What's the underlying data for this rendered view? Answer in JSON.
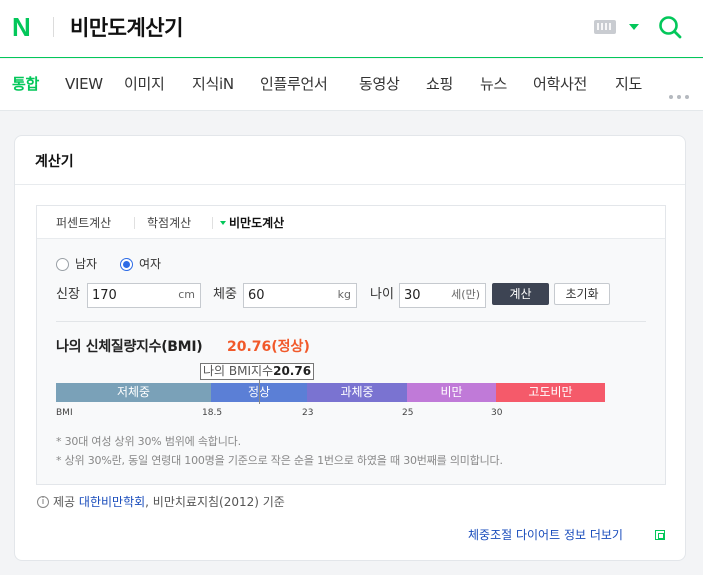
{
  "header": {
    "logo": "N",
    "search_query": "비만도계산기",
    "icons": [
      "keyboard-icon",
      "dropdown-triangle-icon",
      "search-icon"
    ]
  },
  "nav_tabs": [
    {
      "label": "통합",
      "active": true
    },
    {
      "label": "VIEW",
      "active": false
    },
    {
      "label": "이미지",
      "active": false
    },
    {
      "label": "지식iN",
      "active": false
    },
    {
      "label": "인플루언서",
      "active": false
    },
    {
      "label": "동영상",
      "active": false
    },
    {
      "label": "쇼핑",
      "active": false
    },
    {
      "label": "뉴스",
      "active": false
    },
    {
      "label": "어학사전",
      "active": false
    },
    {
      "label": "지도",
      "active": false
    }
  ],
  "calculator": {
    "title": "계산기",
    "tabs": [
      "퍼센트계산",
      "학점계산",
      "비만도계산"
    ],
    "active_tab": "비만도계산",
    "gender": {
      "options": [
        "남자",
        "여자"
      ],
      "selected": "여자"
    },
    "height": {
      "label": "신장",
      "value": "170",
      "unit": "cm"
    },
    "weight": {
      "label": "체중",
      "value": "60",
      "unit": "kg"
    },
    "age": {
      "label": "나이",
      "value": "30",
      "unit": "세(만)"
    },
    "calculate_button": "계산",
    "reset_button": "초기화",
    "result": {
      "label": "나의 신체질량지수(BMI)",
      "value": "20.76(정상)",
      "marker_prefix": "나의 BMI지수",
      "marker_value": "20.76",
      "bmi": 20.76
    },
    "scale": {
      "segments": [
        {
          "label": "저체중",
          "color": "#7aa1b8"
        },
        {
          "label": "정상",
          "color": "#5b7fd6"
        },
        {
          "label": "과체중",
          "color": "#7a73d1"
        },
        {
          "label": "비만",
          "color": "#c07ad8"
        },
        {
          "label": "고도비만",
          "color": "#f55a6a"
        }
      ],
      "ticks": [
        "BMI",
        "18.5",
        "23",
        "25",
        "30"
      ]
    },
    "notes": [
      "* 30대 여성 상위 30% 범위에 속합니다.",
      "* 상위 30%란, 동일 연령대 100명을 기준으로 작은 순을 1번으로 하였을 때 30번째를 의미합니다."
    ],
    "source": {
      "prefix": "제공",
      "link": "대한비만학회",
      "suffix": ", 비만치료지침(2012) 기준"
    },
    "more_link": "체중조절 다이어트 정보 더보기"
  },
  "colors": {
    "brand": "#03c75a",
    "result": "#f1592a",
    "link": "#1a4dbc"
  }
}
